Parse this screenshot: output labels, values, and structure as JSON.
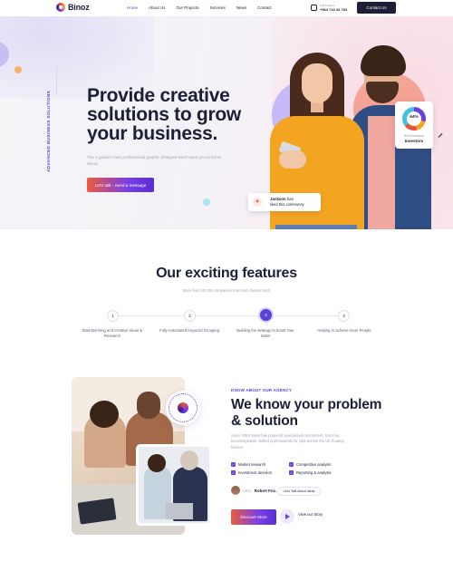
{
  "brand": {
    "name": "Binoz"
  },
  "nav": {
    "items": [
      {
        "label": "Home",
        "active": true
      },
      {
        "label": "About Us",
        "active": false
      },
      {
        "label": "Our Projects",
        "active": false
      },
      {
        "label": "Services",
        "active": false
      },
      {
        "label": "News",
        "active": false
      },
      {
        "label": "Contact",
        "active": false
      }
    ],
    "call_label": "Call Anytime",
    "phone": "+964 742 44 763",
    "cta": "Contact Us"
  },
  "hero": {
    "vertical_text": "ADVANCED BUSINESS SOLUTIONS",
    "title": "Provide creative solutions to grow your business.",
    "subtitle": "The 3 golden main professional graphic designer won't want you to know about.",
    "button": "Let's talk - Send a message",
    "stat": {
      "value": "64%",
      "line1": "84% increase",
      "line2": "Investors"
    },
    "testimonial": {
      "name": "Jackson",
      "name_suffix": "has",
      "text": "liked this community"
    }
  },
  "features": {
    "title": "Our exciting features",
    "subtitle": "More than 10,000 companies trust and choose Itech",
    "steps": [
      {
        "num": "1",
        "label": "Brainstorming and Creative Ideas & Research"
      },
      {
        "num": "2",
        "label": "Fully Automated Keyword Grouping"
      },
      {
        "num": "3",
        "label": "Building the strategy to boost Your Sales"
      },
      {
        "num": "4",
        "label": "Helping to achieve more People"
      }
    ]
  },
  "agency": {
    "kicker": "KNOW ABOUT OUR AGENCY",
    "title": "We know your problem & solution",
    "text": "Since 1983 Mess has powered specialized recruitment, sourcing knowledgeable, skilled professionals for jobs across the UK floating finance.",
    "checks": [
      "Market research",
      "Competitive analysis",
      "Investment decision",
      "Reporting & analysis"
    ],
    "ceo_role": "CEO,",
    "ceo_name": "Robert Fox.",
    "ceo_cta": "Let's Talk About Ideas",
    "discover_button": "Discover More",
    "story_label": "View our Story"
  },
  "colors": {
    "accent": "#5a3fd8",
    "dark": "#1c1f35",
    "orange": "#ec5a3c"
  }
}
